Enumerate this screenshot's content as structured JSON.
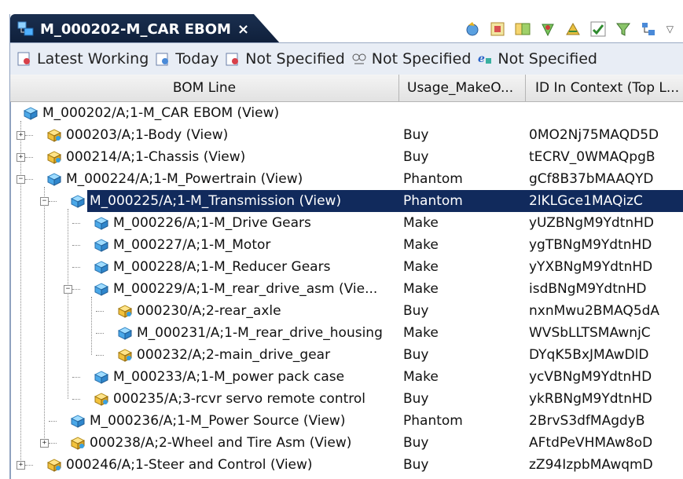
{
  "tab": {
    "title": "M_000202-M_CAR EBOM",
    "close": "×"
  },
  "toolbar": {
    "icons": [
      "refresh-icon",
      "structure-icon",
      "compare-icon",
      "marker-icon",
      "split-icon",
      "check-icon",
      "filter-icon",
      "tree-icon"
    ],
    "menu": "▽"
  },
  "revision_rules": [
    {
      "icon": "rule-icon",
      "label": "Latest Working"
    },
    {
      "icon": "date-icon",
      "label": "Today"
    },
    {
      "icon": "unit-icon",
      "label": "Not Specified"
    },
    {
      "icon": "variant-icon",
      "label": "Not Specified"
    },
    {
      "icon": "effectivity-icon",
      "label": "Not Specified"
    }
  ],
  "columns": {
    "bom_line": "BOM Line",
    "usage": "Usage_MakeO...",
    "id_in_context": "ID In Context (Top L..."
  },
  "rows": [
    {
      "label": "M_000202/A;1-M_CAR EBOM (View)",
      "usage": "",
      "id": "",
      "level": 0,
      "expander": "",
      "icon": "assembly-blue"
    },
    {
      "label": "000203/A;1-Body (View)",
      "usage": "Buy",
      "id": "0MO2Nj75MAQD5D",
      "level": 1,
      "expander": "+",
      "icon": "part-yellow"
    },
    {
      "label": "000214/A;1-Chassis (View)",
      "usage": "Buy",
      "id": "tECRV_0WMAQpgB",
      "level": 1,
      "expander": "+",
      "icon": "part-yellow"
    },
    {
      "label": "M_000224/A;1-M_Powertrain (View)",
      "usage": "Phantom",
      "id": "gCf8B37bMAAQYD",
      "level": 1,
      "expander": "−",
      "icon": "assembly-blue"
    },
    {
      "label": "M_000225/A;1-M_Transmission (View)",
      "usage": "Phantom",
      "id": "2lKLGce1MAQizC",
      "level": 2,
      "expander": "−",
      "icon": "assembly-blue",
      "selected": true
    },
    {
      "label": "M_000226/A;1-M_Drive Gears",
      "usage": "Make",
      "id": "yUZBNgM9YdtnHD",
      "level": 3,
      "expander": "",
      "icon": "assembly-blue"
    },
    {
      "label": "M_000227/A;1-M_Motor",
      "usage": "Make",
      "id": "ygTBNgM9YdtnHD",
      "level": 3,
      "expander": "",
      "icon": "assembly-blue"
    },
    {
      "label": "M_000228/A;1-M_Reducer Gears",
      "usage": "Make",
      "id": "yYXBNgM9YdtnHD",
      "level": 3,
      "expander": "",
      "icon": "assembly-blue"
    },
    {
      "label": "M_000229/A;1-M_rear_drive_asm (Vie...",
      "usage": "Make",
      "id": "isdBNgM9YdtnHD",
      "level": 3,
      "expander": "−",
      "icon": "assembly-blue"
    },
    {
      "label": "000230/A;2-rear_axle",
      "usage": "Buy",
      "id": "nxnMwu2BMAQ5dA",
      "level": 4,
      "expander": "",
      "icon": "part-yellow"
    },
    {
      "label": "M_000231/A;1-M_rear_drive_housing",
      "usage": "Make",
      "id": "WVSbLLTSMAwnjC",
      "level": 4,
      "expander": "",
      "icon": "assembly-blue"
    },
    {
      "label": "000232/A;2-main_drive_gear",
      "usage": "Buy",
      "id": "DYqK5BxJMAwDlD",
      "level": 4,
      "expander": "",
      "icon": "part-yellow"
    },
    {
      "label": "M_000233/A;1-M_power pack case",
      "usage": "Make",
      "id": "ycVBNgM9YdtnHD",
      "level": 3,
      "expander": "",
      "icon": "assembly-blue"
    },
    {
      "label": "000235/A;3-rcvr servo remote control",
      "usage": "Buy",
      "id": "ykRBNgM9YdtnHD",
      "level": 3,
      "expander": "",
      "icon": "part-yellow"
    },
    {
      "label": "M_000236/A;1-M_Power Source (View)",
      "usage": "Phantom",
      "id": "2BrvS3dfMAgdyB",
      "level": 2,
      "expander": "",
      "icon": "assembly-blue"
    },
    {
      "label": "000238/A;2-Wheel and Tire Asm (View)",
      "usage": "Buy",
      "id": "AFtdPeVHMAw8oD",
      "level": 2,
      "expander": "+",
      "icon": "part-yellow"
    },
    {
      "label": "000246/A;1-Steer and Control (View)",
      "usage": "Buy",
      "id": "zZ94IzpbMAwqmD",
      "level": 1,
      "expander": "+",
      "icon": "part-yellow"
    }
  ],
  "colors": {
    "tab_bg": "#13284a",
    "selection_bg": "#112a5c",
    "revbar_bg": "#e8edf5",
    "header_bg": "#e6e6e6"
  }
}
